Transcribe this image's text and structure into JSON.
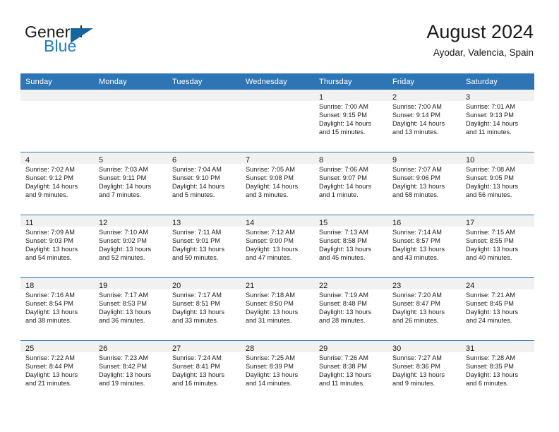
{
  "brand": {
    "word1": "General",
    "word2": "Blue",
    "logo_icon": "triangle-logo-icon",
    "accent_color": "#1f7ac4",
    "triangle_color": "#15659f"
  },
  "header": {
    "title": "August 2024",
    "subtitle": "Ayodar, Valencia, Spain"
  },
  "calendar": {
    "header_color": "#2e75b6",
    "daynum_band_color": "#f1f1f1",
    "weekday_headers": [
      "Sunday",
      "Monday",
      "Tuesday",
      "Wednesday",
      "Thursday",
      "Friday",
      "Saturday"
    ],
    "weeks": [
      [
        {
          "day": "",
          "sunrise": "",
          "sunset": "",
          "daylight_line1": "",
          "daylight_line2": ""
        },
        {
          "day": "",
          "sunrise": "",
          "sunset": "",
          "daylight_line1": "",
          "daylight_line2": ""
        },
        {
          "day": "",
          "sunrise": "",
          "sunset": "",
          "daylight_line1": "",
          "daylight_line2": ""
        },
        {
          "day": "",
          "sunrise": "",
          "sunset": "",
          "daylight_line1": "",
          "daylight_line2": ""
        },
        {
          "day": "1",
          "sunrise": "Sunrise: 7:00 AM",
          "sunset": "Sunset: 9:15 PM",
          "daylight_line1": "Daylight: 14 hours",
          "daylight_line2": "and 15 minutes."
        },
        {
          "day": "2",
          "sunrise": "Sunrise: 7:00 AM",
          "sunset": "Sunset: 9:14 PM",
          "daylight_line1": "Daylight: 14 hours",
          "daylight_line2": "and 13 minutes."
        },
        {
          "day": "3",
          "sunrise": "Sunrise: 7:01 AM",
          "sunset": "Sunset: 9:13 PM",
          "daylight_line1": "Daylight: 14 hours",
          "daylight_line2": "and 11 minutes."
        }
      ],
      [
        {
          "day": "4",
          "sunrise": "Sunrise: 7:02 AM",
          "sunset": "Sunset: 9:12 PM",
          "daylight_line1": "Daylight: 14 hours",
          "daylight_line2": "and 9 minutes."
        },
        {
          "day": "5",
          "sunrise": "Sunrise: 7:03 AM",
          "sunset": "Sunset: 9:11 PM",
          "daylight_line1": "Daylight: 14 hours",
          "daylight_line2": "and 7 minutes."
        },
        {
          "day": "6",
          "sunrise": "Sunrise: 7:04 AM",
          "sunset": "Sunset: 9:10 PM",
          "daylight_line1": "Daylight: 14 hours",
          "daylight_line2": "and 5 minutes."
        },
        {
          "day": "7",
          "sunrise": "Sunrise: 7:05 AM",
          "sunset": "Sunset: 9:08 PM",
          "daylight_line1": "Daylight: 14 hours",
          "daylight_line2": "and 3 minutes."
        },
        {
          "day": "8",
          "sunrise": "Sunrise: 7:06 AM",
          "sunset": "Sunset: 9:07 PM",
          "daylight_line1": "Daylight: 14 hours",
          "daylight_line2": "and 1 minute."
        },
        {
          "day": "9",
          "sunrise": "Sunrise: 7:07 AM",
          "sunset": "Sunset: 9:06 PM",
          "daylight_line1": "Daylight: 13 hours",
          "daylight_line2": "and 58 minutes."
        },
        {
          "day": "10",
          "sunrise": "Sunrise: 7:08 AM",
          "sunset": "Sunset: 9:05 PM",
          "daylight_line1": "Daylight: 13 hours",
          "daylight_line2": "and 56 minutes."
        }
      ],
      [
        {
          "day": "11",
          "sunrise": "Sunrise: 7:09 AM",
          "sunset": "Sunset: 9:03 PM",
          "daylight_line1": "Daylight: 13 hours",
          "daylight_line2": "and 54 minutes."
        },
        {
          "day": "12",
          "sunrise": "Sunrise: 7:10 AM",
          "sunset": "Sunset: 9:02 PM",
          "daylight_line1": "Daylight: 13 hours",
          "daylight_line2": "and 52 minutes."
        },
        {
          "day": "13",
          "sunrise": "Sunrise: 7:11 AM",
          "sunset": "Sunset: 9:01 PM",
          "daylight_line1": "Daylight: 13 hours",
          "daylight_line2": "and 50 minutes."
        },
        {
          "day": "14",
          "sunrise": "Sunrise: 7:12 AM",
          "sunset": "Sunset: 9:00 PM",
          "daylight_line1": "Daylight: 13 hours",
          "daylight_line2": "and 47 minutes."
        },
        {
          "day": "15",
          "sunrise": "Sunrise: 7:13 AM",
          "sunset": "Sunset: 8:58 PM",
          "daylight_line1": "Daylight: 13 hours",
          "daylight_line2": "and 45 minutes."
        },
        {
          "day": "16",
          "sunrise": "Sunrise: 7:14 AM",
          "sunset": "Sunset: 8:57 PM",
          "daylight_line1": "Daylight: 13 hours",
          "daylight_line2": "and 43 minutes."
        },
        {
          "day": "17",
          "sunrise": "Sunrise: 7:15 AM",
          "sunset": "Sunset: 8:55 PM",
          "daylight_line1": "Daylight: 13 hours",
          "daylight_line2": "and 40 minutes."
        }
      ],
      [
        {
          "day": "18",
          "sunrise": "Sunrise: 7:16 AM",
          "sunset": "Sunset: 8:54 PM",
          "daylight_line1": "Daylight: 13 hours",
          "daylight_line2": "and 38 minutes."
        },
        {
          "day": "19",
          "sunrise": "Sunrise: 7:17 AM",
          "sunset": "Sunset: 8:53 PM",
          "daylight_line1": "Daylight: 13 hours",
          "daylight_line2": "and 36 minutes."
        },
        {
          "day": "20",
          "sunrise": "Sunrise: 7:17 AM",
          "sunset": "Sunset: 8:51 PM",
          "daylight_line1": "Daylight: 13 hours",
          "daylight_line2": "and 33 minutes."
        },
        {
          "day": "21",
          "sunrise": "Sunrise: 7:18 AM",
          "sunset": "Sunset: 8:50 PM",
          "daylight_line1": "Daylight: 13 hours",
          "daylight_line2": "and 31 minutes."
        },
        {
          "day": "22",
          "sunrise": "Sunrise: 7:19 AM",
          "sunset": "Sunset: 8:48 PM",
          "daylight_line1": "Daylight: 13 hours",
          "daylight_line2": "and 28 minutes."
        },
        {
          "day": "23",
          "sunrise": "Sunrise: 7:20 AM",
          "sunset": "Sunset: 8:47 PM",
          "daylight_line1": "Daylight: 13 hours",
          "daylight_line2": "and 26 minutes."
        },
        {
          "day": "24",
          "sunrise": "Sunrise: 7:21 AM",
          "sunset": "Sunset: 8:45 PM",
          "daylight_line1": "Daylight: 13 hours",
          "daylight_line2": "and 24 minutes."
        }
      ],
      [
        {
          "day": "25",
          "sunrise": "Sunrise: 7:22 AM",
          "sunset": "Sunset: 8:44 PM",
          "daylight_line1": "Daylight: 13 hours",
          "daylight_line2": "and 21 minutes."
        },
        {
          "day": "26",
          "sunrise": "Sunrise: 7:23 AM",
          "sunset": "Sunset: 8:42 PM",
          "daylight_line1": "Daylight: 13 hours",
          "daylight_line2": "and 19 minutes."
        },
        {
          "day": "27",
          "sunrise": "Sunrise: 7:24 AM",
          "sunset": "Sunset: 8:41 PM",
          "daylight_line1": "Daylight: 13 hours",
          "daylight_line2": "and 16 minutes."
        },
        {
          "day": "28",
          "sunrise": "Sunrise: 7:25 AM",
          "sunset": "Sunset: 8:39 PM",
          "daylight_line1": "Daylight: 13 hours",
          "daylight_line2": "and 14 minutes."
        },
        {
          "day": "29",
          "sunrise": "Sunrise: 7:26 AM",
          "sunset": "Sunset: 8:38 PM",
          "daylight_line1": "Daylight: 13 hours",
          "daylight_line2": "and 11 minutes."
        },
        {
          "day": "30",
          "sunrise": "Sunrise: 7:27 AM",
          "sunset": "Sunset: 8:36 PM",
          "daylight_line1": "Daylight: 13 hours",
          "daylight_line2": "and 9 minutes."
        },
        {
          "day": "31",
          "sunrise": "Sunrise: 7:28 AM",
          "sunset": "Sunset: 8:35 PM",
          "daylight_line1": "Daylight: 13 hours",
          "daylight_line2": "and 6 minutes."
        }
      ]
    ]
  }
}
